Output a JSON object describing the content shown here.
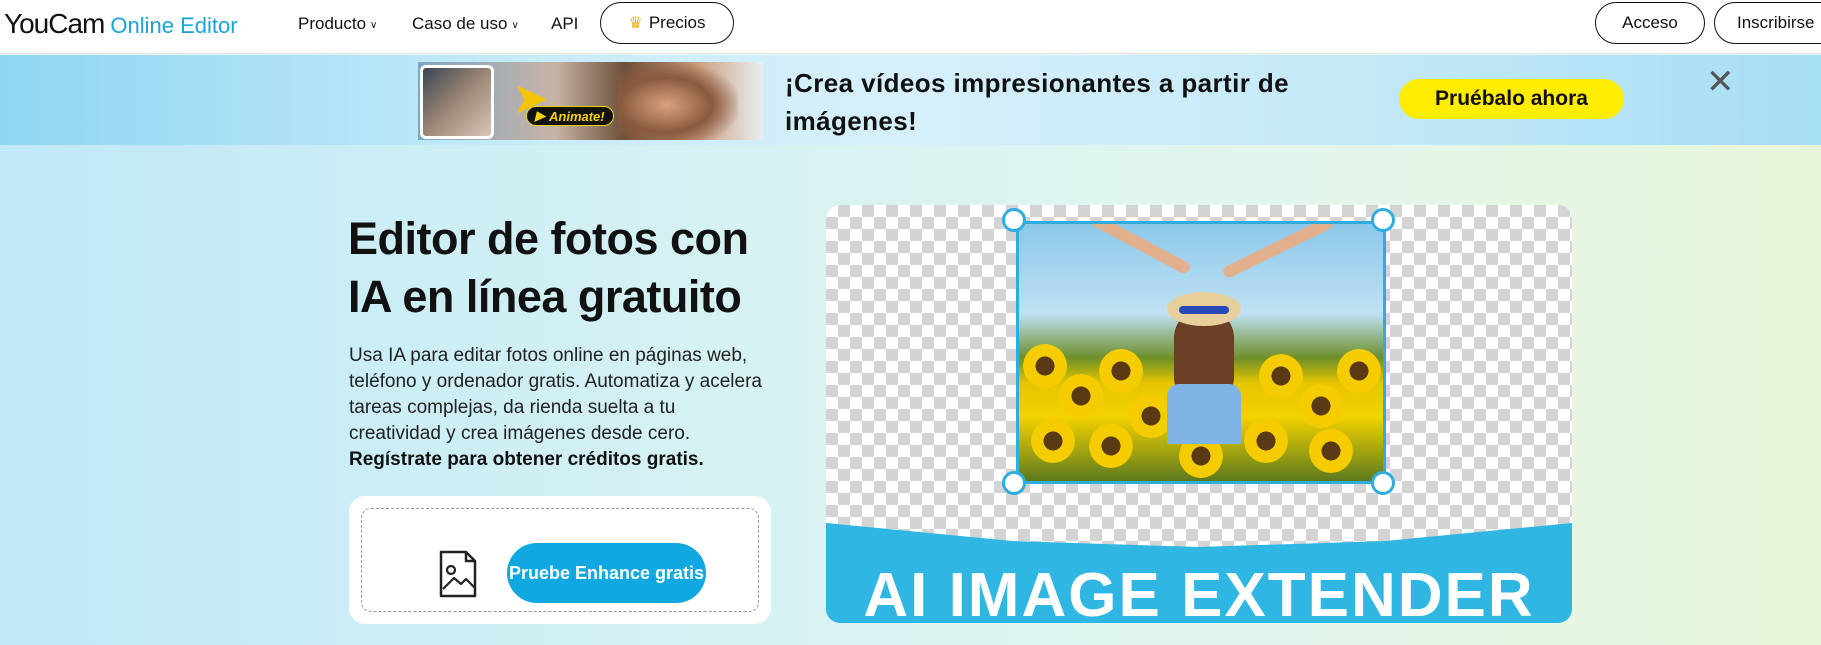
{
  "nav": {
    "logo_primary": "YouCam",
    "logo_secondary": "Online Editor",
    "product": "Producto",
    "use_cases": "Caso de uso",
    "api": "API",
    "pricing": "Precios",
    "login": "Acceso",
    "signup": "Inscribirse"
  },
  "banner": {
    "promo_tag": "Animate!",
    "text": "¡Crea vídeos impresionantes a partir de imágenes!",
    "cta": "Pruébalo ahora",
    "close": "✕"
  },
  "hero": {
    "title": "Editor de fotos con IA en línea gratuito",
    "description": "Usa IA para editar fotos online en páginas web, teléfono y ordenador gratis. Automatiza y acelera tareas complejas, da rienda suelta a tu creatividad y crea imágenes desde cero.",
    "description_bold": "Regístrate para obtener créditos gratis.",
    "upload_button": "Pruebe Enhance gratis",
    "visual_ribbon": "AI IMAGE EXTENDER"
  },
  "colors": {
    "accent": "#11a7e0",
    "logo_blue": "#1aa3d8",
    "cta_yellow": "#ffed00",
    "ribbon_blue": "#2fb6e2"
  },
  "icons": {
    "pricing": "crown-icon",
    "dropdown": "chevron-down-icon",
    "close": "close-icon",
    "upload": "image-file-icon"
  }
}
